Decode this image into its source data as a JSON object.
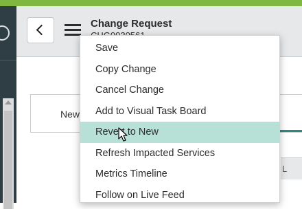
{
  "header": {
    "title": "Change Request",
    "subtitle": "CHG0030561"
  },
  "content": {
    "state_label": "New",
    "right_box_label": "L"
  },
  "context_menu": {
    "items": [
      {
        "label": "Save"
      },
      {
        "label": "Copy Change"
      },
      {
        "label": "Cancel Change"
      },
      {
        "label": "Add to Visual Task Board"
      },
      {
        "label": "Revert to New",
        "hovered": true
      },
      {
        "label": "Refresh Impacted Services"
      },
      {
        "label": "Metrics Timeline"
      },
      {
        "label": "Follow on Live Feed"
      }
    ]
  },
  "colors": {
    "accent_bar": "#80b741",
    "sidebar": "#2f3d44",
    "hover_highlight": "#b7e1d7",
    "progress": "#2d8a7e"
  },
  "icons": {
    "back": "chevron-left-icon",
    "menu": "hamburger-icon",
    "pointer": "mouse-cursor-icon"
  }
}
